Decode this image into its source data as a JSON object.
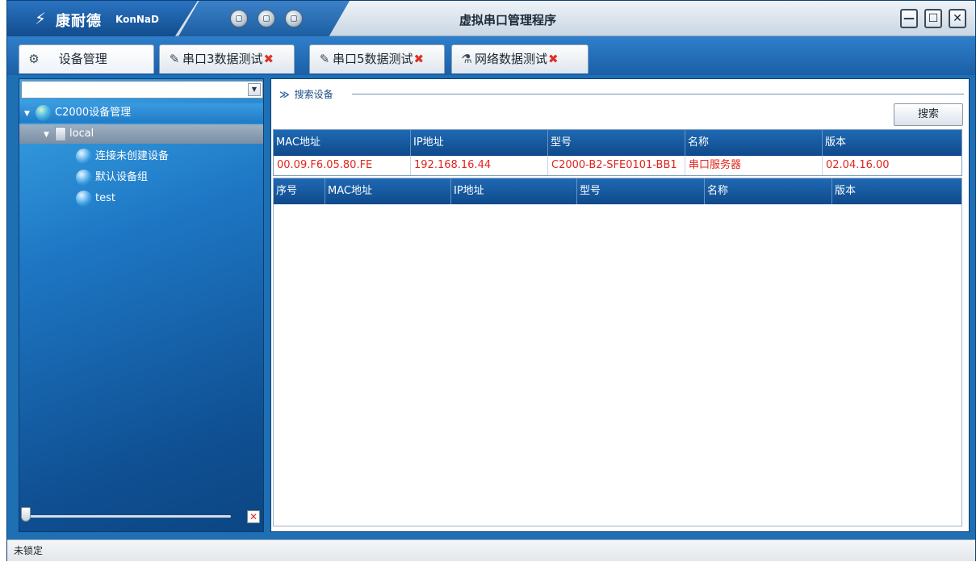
{
  "app": {
    "logo_mark": "⚡",
    "logo_cn": "康耐德",
    "logo_en": "KonNaD",
    "title": "虚拟串口管理程序",
    "window_buttons": {
      "minimize": "—",
      "maximize": "☐",
      "close": "✕"
    }
  },
  "tabs": [
    {
      "label": "设备管理",
      "icon": "gear-icon",
      "glyph": "⚙",
      "closable": false,
      "active": true
    },
    {
      "label": "串口3数据测试",
      "icon": "plug-icon",
      "glyph": "✎",
      "closable": true,
      "active": false
    },
    {
      "label": "串口5数据测试",
      "icon": "plug-icon",
      "glyph": "✎",
      "closable": true,
      "active": false
    },
    {
      "label": "网络数据测试",
      "icon": "flask-icon",
      "glyph": "⚗",
      "closable": true,
      "active": false
    }
  ],
  "tab_close_glyph": "✖",
  "left_panel": {
    "dropdown_value": "",
    "tree": [
      {
        "label": "C2000设备管理",
        "level": 0,
        "expanded": true
      },
      {
        "label": "local",
        "level": 1,
        "expanded": true
      },
      {
        "label": "连接未创建设备",
        "level": 2
      },
      {
        "label": "默认设备组",
        "level": 2
      },
      {
        "label": "test",
        "level": 2
      }
    ],
    "clear_glyph": "✕"
  },
  "search_section": {
    "chevron": "≫",
    "title": "搜索设备",
    "search_button": "搜索"
  },
  "search_results": {
    "columns": [
      "MAC地址",
      "IP地址",
      "型号",
      "名称",
      "版本"
    ],
    "rows": [
      [
        "00.09.F6.05.80.FE",
        "192.168.16.44",
        "C2000-B2-SFE0101-BB1",
        "串口服务器",
        "02.04.16.00"
      ]
    ]
  },
  "device_table": {
    "columns": [
      "序号",
      "MAC地址",
      "IP地址",
      "型号",
      "名称",
      "版本"
    ],
    "rows": []
  },
  "status": {
    "text": "未锁定"
  }
}
